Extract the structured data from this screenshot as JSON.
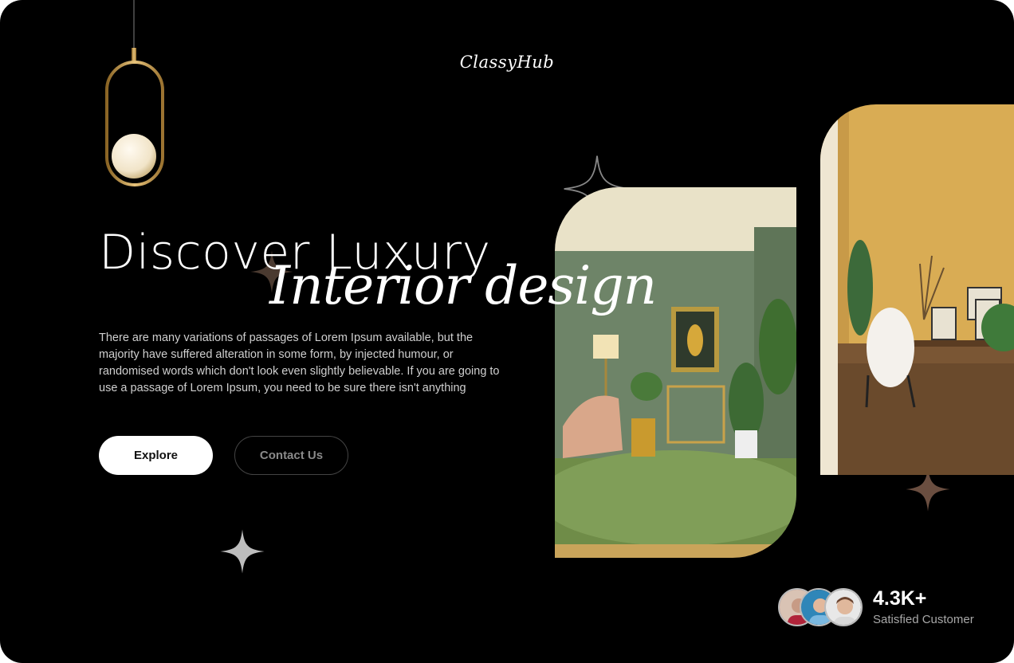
{
  "brand": {
    "logo": "ClassyHub"
  },
  "hero": {
    "headline_line1": "Discover Luxury",
    "headline_line2": "Interior design",
    "description": "There are many variations of passages of Lorem Ipsum available, but the majority have suffered alteration in some form, by injected humour, or randomised words which don't look even slightly believable. If you are going to use a passage of Lorem Ipsum, you need to be sure there isn't anything"
  },
  "actions": {
    "explore_label": "Explore",
    "contact_label": "Contact Us"
  },
  "stats": {
    "count": "4.3K+",
    "label": "Satisfied Customer"
  },
  "colors": {
    "background": "#000000",
    "text_primary": "#ffffff",
    "lamp_gold": "#c9a24a"
  },
  "icons": [
    "pendant-lamp-icon",
    "sparkle-icon"
  ]
}
